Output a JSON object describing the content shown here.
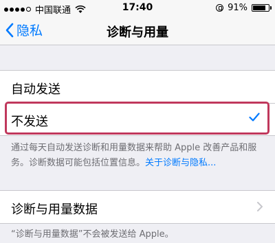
{
  "status_bar": {
    "carrier": "中国联通",
    "time": "17:40",
    "battery_percent": "91%",
    "battery_level": 0.91,
    "signal_bars": 5,
    "signal_filled": 4
  },
  "nav": {
    "back_label": "隐私",
    "title": "诊断与用量"
  },
  "options": {
    "auto_send": "自动发送",
    "dont_send": "不发送",
    "selected": "dont_send"
  },
  "description": {
    "text": "通过每天自动发送诊断和用量数据来帮助 Apple 改善产品和服务。诊断数据可能包括位置信息。",
    "link": "关于诊断与隐私..."
  },
  "data_row": {
    "label": "诊断与用量数据"
  },
  "footer_note": "“诊断与用量数据”不会被发送给 Apple。",
  "colors": {
    "accent": "#007aff",
    "highlight": "#c0385c",
    "background": "#efeff4"
  }
}
